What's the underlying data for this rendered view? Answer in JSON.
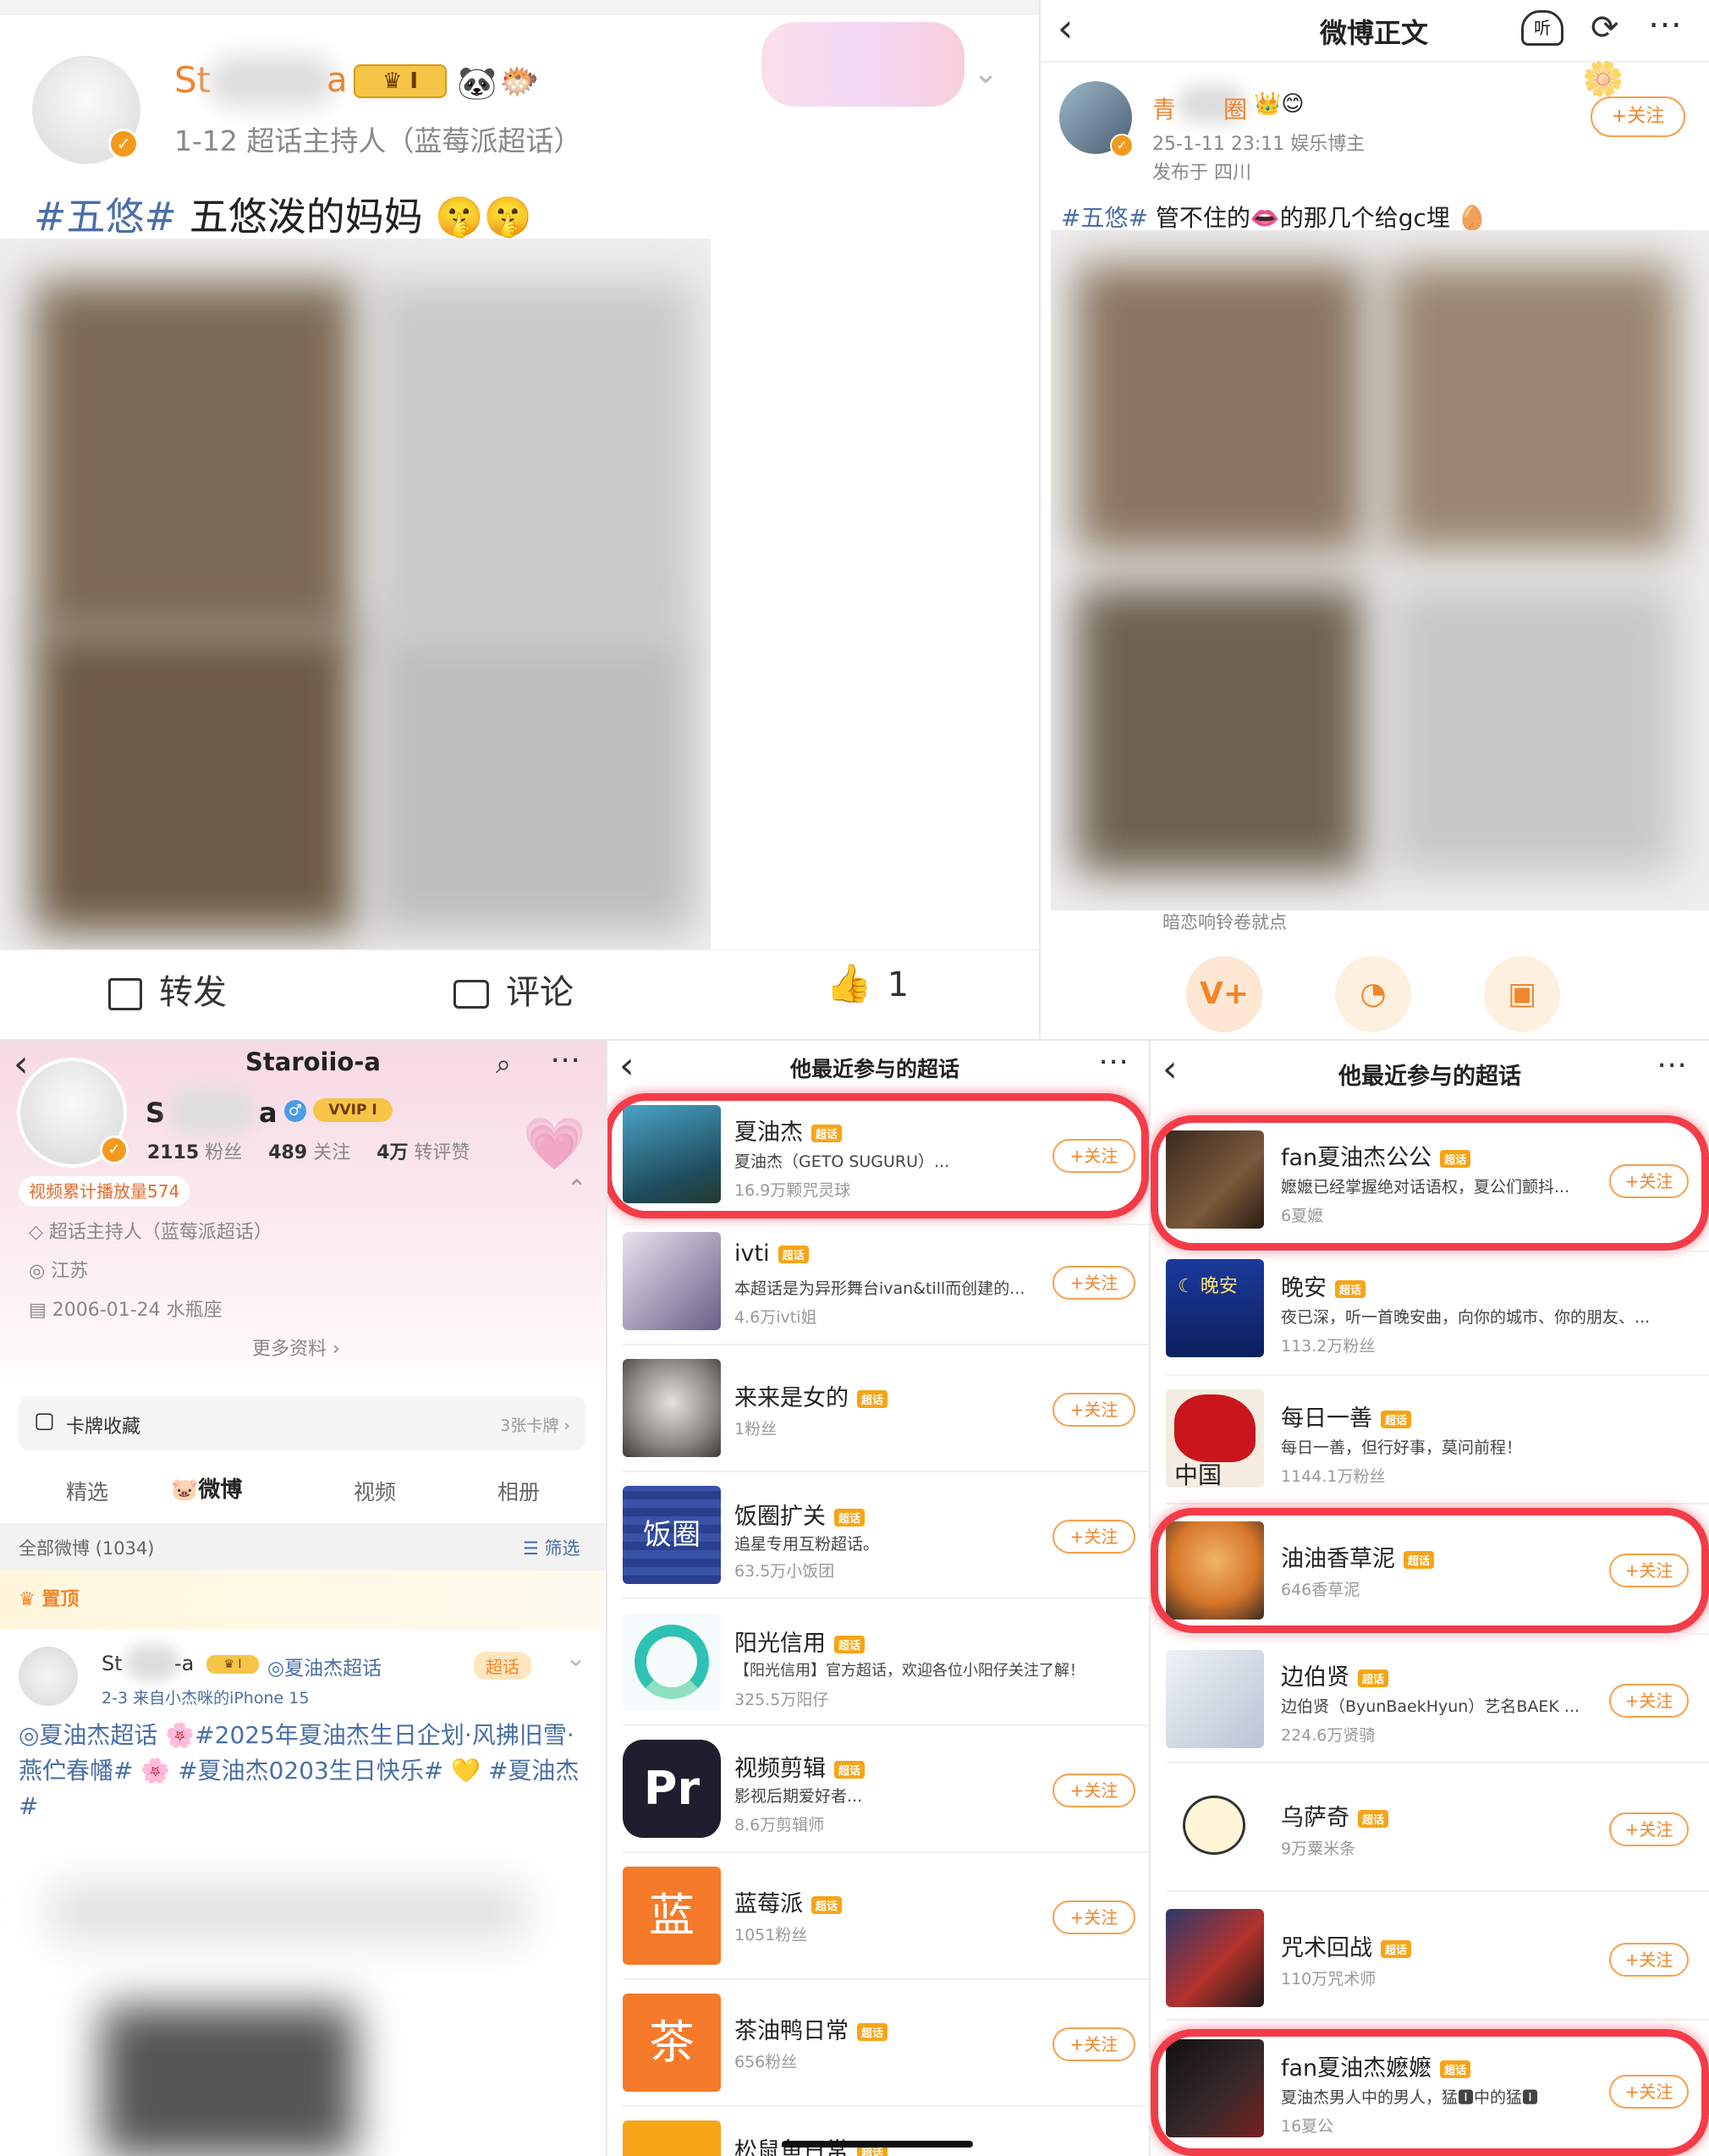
{
  "post_a": {
    "user_name_visible": "St",
    "user_name_tail": "a",
    "vip_level": "I",
    "meta": "1-12  超话主持人（蓝莓派超话）",
    "tag": "#五悠#",
    "text": "五悠泼的妈妈",
    "actions": {
      "repost": "转发",
      "comment": "评论",
      "like_count": "1"
    }
  },
  "post_b": {
    "title": "微博正文",
    "listen": "听",
    "user_name_visible": "青",
    "user_name_tail": "圈",
    "time": "25-1-11 23:11  娱乐博主",
    "location": "发布于 四川",
    "follow": "+关注",
    "tag": "#五悠#",
    "text": "管不住的👄的那几个给gc埋",
    "ad_text": "暗恋响铃卷就点"
  },
  "profile": {
    "name": "Staroiio-a",
    "name_visible": "S",
    "name_tail": "a",
    "vip": "VVIP I",
    "fans": "2115",
    "fans_label": "粉丝",
    "follows": "489",
    "follows_label": "关注",
    "likes": "4万",
    "likes_label": "转评赞",
    "video_plays": "视频累计播放量574",
    "info": [
      "超话主持人（蓝莓派超话）",
      "江苏",
      "2006-01-24 水瓶座"
    ],
    "more": "更多资料 ›",
    "cards_label": "卡牌收藏",
    "cards_count": "3张卡牌 ›",
    "tabs": [
      "精选",
      "微博",
      "视频",
      "相册"
    ],
    "all_weibo": "全部微博 (1034)",
    "filter": "筛选",
    "pinned": "置顶",
    "post_user": "St",
    "post_user_tail": "-a",
    "post_topic": "夏油杰超话",
    "post_meta": "2-3  来自小杰咪的iPhone 15",
    "post_text": "◎夏油杰超话 🌸#2025年夏油杰生日企划·风拂旧雪·燕伫春幡# 🌸 #夏油杰0203生日快乐# 💛 #夏油杰#",
    "badge": "超话"
  },
  "list_a": {
    "title": "他最近参与的超话",
    "chip": "超话",
    "follow": "+关注",
    "items": [
      {
        "name": "夏油杰",
        "desc": "夏油杰（GETO SUGURU）...",
        "meta": "16.9万颗咒灵球"
      },
      {
        "name": "ivti",
        "desc": "本超话是为异形舞台ivan&till而创建的...",
        "meta": "4.6万ivti姐"
      },
      {
        "name": "来来是女的",
        "desc": "",
        "meta": "1粉丝"
      },
      {
        "name": "饭圈扩关",
        "desc": "追星专用互粉超话。",
        "meta": "63.5万小饭团"
      },
      {
        "name": "阳光信用",
        "desc": "【阳光信用】官方超话，欢迎各位小阳仔关注了解！",
        "meta": "325.5万阳仔"
      },
      {
        "name": "视频剪辑",
        "desc": "影视后期爱好者...",
        "meta": "8.6万剪辑师"
      },
      {
        "name": "蓝莓派",
        "desc": "",
        "meta": "1051粉丝"
      },
      {
        "name": "茶油鸭日常",
        "desc": "",
        "meta": "656粉丝"
      },
      {
        "name": "松鼠鱼日常",
        "desc": "",
        "meta": ""
      }
    ],
    "icon_letters": {
      "pr": "Pr",
      "lan": "蓝",
      "cha": "茶"
    }
  },
  "list_b": {
    "title": "他最近参与的超话",
    "chip": "超话",
    "follow": "+关注",
    "items": [
      {
        "name": "fan夏油杰公公",
        "desc": "嬷嬷已经掌握绝对话语权，夏公们颤抖...",
        "meta": "6夏嬷"
      },
      {
        "name": "晚安",
        "desc": "夜已深，听一首晚安曲，向你的城市、你的朋友、...",
        "meta": "113.2万粉丝"
      },
      {
        "name": "每日一善",
        "desc": "每日一善，但行好事，莫问前程！",
        "meta": "1144.1万粉丝"
      },
      {
        "name": "油油香草泥",
        "desc": "",
        "meta": "646香草泥"
      },
      {
        "name": "边伯贤",
        "desc": "边伯贤（ByunBaekHyun）艺名BAEK ...",
        "meta": "224.6万贤骑"
      },
      {
        "name": "乌萨奇",
        "desc": "",
        "meta": "9万粟米条"
      },
      {
        "name": "咒术回战",
        "desc": "",
        "meta": "110万咒术师"
      },
      {
        "name": "fan夏油杰嬷嬷",
        "desc": "夏油杰男人中的男人，猛🅸中的猛🅸",
        "meta": "16夏公"
      }
    ]
  },
  "colors": {
    "accent": "#f2862a",
    "link": "#4a6fa5",
    "highlight": "#f43c49",
    "chip": "#f7a417"
  }
}
